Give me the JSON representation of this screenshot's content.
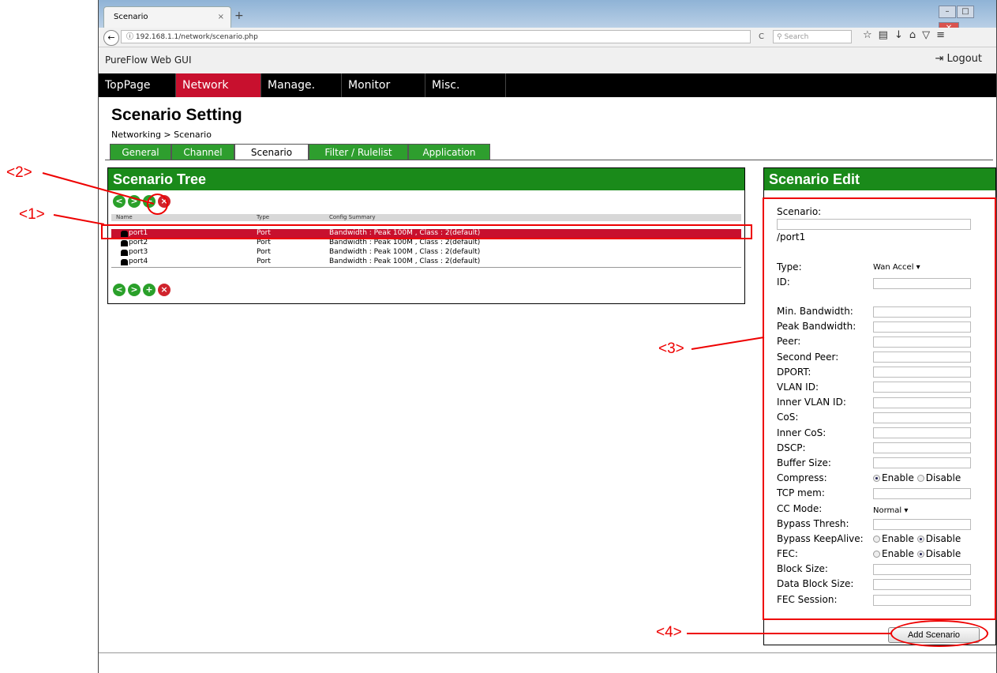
{
  "browser": {
    "tab_title": "Scenario",
    "tab_close": "×",
    "new_tab": "+",
    "url": "192.168.1.1/network/scenario.php",
    "search_placeholder": "Search",
    "toolbar_icons": [
      "star-icon",
      "bookmark-list-icon",
      "download-icon",
      "home-icon",
      "pocket-icon",
      "menu-icon"
    ]
  },
  "app": {
    "title": "PureFlow Web GUI",
    "logout_label": "Logout"
  },
  "menu": [
    {
      "label": "TopPage",
      "active": false
    },
    {
      "label": "Network",
      "active": true
    },
    {
      "label": "Manage.",
      "active": false
    },
    {
      "label": "Monitor",
      "active": false
    },
    {
      "label": "Misc.",
      "active": false
    }
  ],
  "page": {
    "title": "Scenario Setting",
    "breadcrumb": "Networking > Scenario"
  },
  "subtabs": [
    {
      "label": "General",
      "active": false
    },
    {
      "label": "Channel",
      "active": false
    },
    {
      "label": "Scenario",
      "active": true
    },
    {
      "label": "Filter / Rulelist",
      "active": false
    },
    {
      "label": "Application",
      "active": false
    }
  ],
  "tree": {
    "title": "Scenario Tree",
    "buttons": [
      "move-left",
      "move-right",
      "add",
      "delete"
    ],
    "columns": [
      "Name",
      "Type",
      "Config Summary"
    ],
    "rows": [
      {
        "name": "port1",
        "type": "Port",
        "summary": "Bandwidth : Peak 100M , Class : 2(default)",
        "selected": true
      },
      {
        "name": "port2",
        "type": "Port",
        "summary": "Bandwidth : Peak 100M , Class : 2(default)",
        "selected": false
      },
      {
        "name": "port3",
        "type": "Port",
        "summary": "Bandwidth : Peak 100M , Class : 2(default)",
        "selected": false
      },
      {
        "name": "port4",
        "type": "Port",
        "summary": "Bandwidth : Peak 100M , Class : 2(default)",
        "selected": false
      }
    ]
  },
  "edit": {
    "title": "Scenario Edit",
    "scenario_label": "Scenario:",
    "scenario_value": "",
    "path": "/port1",
    "type_label": "Type:",
    "type_value": "Wan Accel",
    "fields": [
      "ID:",
      "Min. Bandwidth:",
      "Peak Bandwidth:",
      "Peer:",
      "Second Peer:",
      "DPORT:",
      "VLAN ID:",
      "Inner VLAN ID:",
      "CoS:",
      "Inner CoS:",
      "DSCP:",
      "Buffer Size:"
    ],
    "compress_label": "Compress:",
    "compress": {
      "enable": "Enable",
      "disable": "Disable",
      "selected": "enable"
    },
    "tcp_mem_label": "TCP mem:",
    "cc_mode_label": "CC Mode:",
    "cc_mode_value": "Normal",
    "bypass_thresh_label": "Bypass Thresh:",
    "bypass_keepalive_label": "Bypass KeepAlive:",
    "bypass_keepalive": {
      "enable": "Enable",
      "disable": "Disable",
      "selected": "disable"
    },
    "fec_label": "FEC:",
    "fec": {
      "enable": "Enable",
      "disable": "Disable",
      "selected": "disable"
    },
    "tail_fields": [
      "Block Size:",
      "Data Block Size:",
      "FEC Session:"
    ],
    "add_button": "Add Scenario"
  },
  "annotations": [
    "<1>",
    "<2>",
    "<3>",
    "<4>"
  ],
  "colors": {
    "accent_red": "#c8102e",
    "panel_green": "#1a8a1a",
    "annotation_red": "#e00000"
  }
}
